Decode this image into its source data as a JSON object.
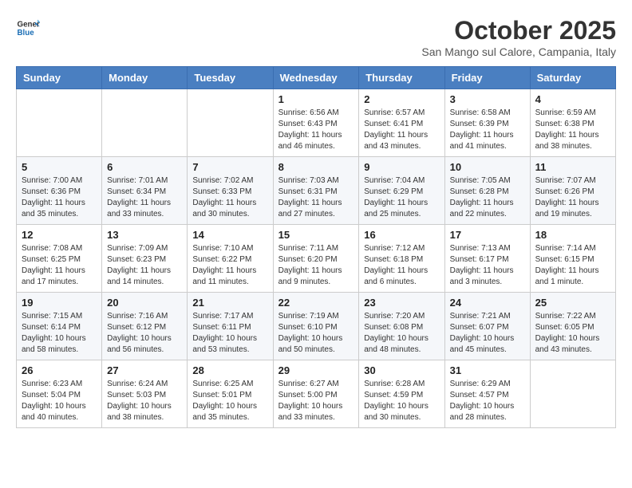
{
  "header": {
    "logo_line1": "General",
    "logo_line2": "Blue",
    "month": "October 2025",
    "location": "San Mango sul Calore, Campania, Italy"
  },
  "days_of_week": [
    "Sunday",
    "Monday",
    "Tuesday",
    "Wednesday",
    "Thursday",
    "Friday",
    "Saturday"
  ],
  "weeks": [
    [
      {
        "day": "",
        "info": ""
      },
      {
        "day": "",
        "info": ""
      },
      {
        "day": "",
        "info": ""
      },
      {
        "day": "1",
        "info": "Sunrise: 6:56 AM\nSunset: 6:43 PM\nDaylight: 11 hours and 46 minutes."
      },
      {
        "day": "2",
        "info": "Sunrise: 6:57 AM\nSunset: 6:41 PM\nDaylight: 11 hours and 43 minutes."
      },
      {
        "day": "3",
        "info": "Sunrise: 6:58 AM\nSunset: 6:39 PM\nDaylight: 11 hours and 41 minutes."
      },
      {
        "day": "4",
        "info": "Sunrise: 6:59 AM\nSunset: 6:38 PM\nDaylight: 11 hours and 38 minutes."
      }
    ],
    [
      {
        "day": "5",
        "info": "Sunrise: 7:00 AM\nSunset: 6:36 PM\nDaylight: 11 hours and 35 minutes."
      },
      {
        "day": "6",
        "info": "Sunrise: 7:01 AM\nSunset: 6:34 PM\nDaylight: 11 hours and 33 minutes."
      },
      {
        "day": "7",
        "info": "Sunrise: 7:02 AM\nSunset: 6:33 PM\nDaylight: 11 hours and 30 minutes."
      },
      {
        "day": "8",
        "info": "Sunrise: 7:03 AM\nSunset: 6:31 PM\nDaylight: 11 hours and 27 minutes."
      },
      {
        "day": "9",
        "info": "Sunrise: 7:04 AM\nSunset: 6:29 PM\nDaylight: 11 hours and 25 minutes."
      },
      {
        "day": "10",
        "info": "Sunrise: 7:05 AM\nSunset: 6:28 PM\nDaylight: 11 hours and 22 minutes."
      },
      {
        "day": "11",
        "info": "Sunrise: 7:07 AM\nSunset: 6:26 PM\nDaylight: 11 hours and 19 minutes."
      }
    ],
    [
      {
        "day": "12",
        "info": "Sunrise: 7:08 AM\nSunset: 6:25 PM\nDaylight: 11 hours and 17 minutes."
      },
      {
        "day": "13",
        "info": "Sunrise: 7:09 AM\nSunset: 6:23 PM\nDaylight: 11 hours and 14 minutes."
      },
      {
        "day": "14",
        "info": "Sunrise: 7:10 AM\nSunset: 6:22 PM\nDaylight: 11 hours and 11 minutes."
      },
      {
        "day": "15",
        "info": "Sunrise: 7:11 AM\nSunset: 6:20 PM\nDaylight: 11 hours and 9 minutes."
      },
      {
        "day": "16",
        "info": "Sunrise: 7:12 AM\nSunset: 6:18 PM\nDaylight: 11 hours and 6 minutes."
      },
      {
        "day": "17",
        "info": "Sunrise: 7:13 AM\nSunset: 6:17 PM\nDaylight: 11 hours and 3 minutes."
      },
      {
        "day": "18",
        "info": "Sunrise: 7:14 AM\nSunset: 6:15 PM\nDaylight: 11 hours and 1 minute."
      }
    ],
    [
      {
        "day": "19",
        "info": "Sunrise: 7:15 AM\nSunset: 6:14 PM\nDaylight: 10 hours and 58 minutes."
      },
      {
        "day": "20",
        "info": "Sunrise: 7:16 AM\nSunset: 6:12 PM\nDaylight: 10 hours and 56 minutes."
      },
      {
        "day": "21",
        "info": "Sunrise: 7:17 AM\nSunset: 6:11 PM\nDaylight: 10 hours and 53 minutes."
      },
      {
        "day": "22",
        "info": "Sunrise: 7:19 AM\nSunset: 6:10 PM\nDaylight: 10 hours and 50 minutes."
      },
      {
        "day": "23",
        "info": "Sunrise: 7:20 AM\nSunset: 6:08 PM\nDaylight: 10 hours and 48 minutes."
      },
      {
        "day": "24",
        "info": "Sunrise: 7:21 AM\nSunset: 6:07 PM\nDaylight: 10 hours and 45 minutes."
      },
      {
        "day": "25",
        "info": "Sunrise: 7:22 AM\nSunset: 6:05 PM\nDaylight: 10 hours and 43 minutes."
      }
    ],
    [
      {
        "day": "26",
        "info": "Sunrise: 6:23 AM\nSunset: 5:04 PM\nDaylight: 10 hours and 40 minutes."
      },
      {
        "day": "27",
        "info": "Sunrise: 6:24 AM\nSunset: 5:03 PM\nDaylight: 10 hours and 38 minutes."
      },
      {
        "day": "28",
        "info": "Sunrise: 6:25 AM\nSunset: 5:01 PM\nDaylight: 10 hours and 35 minutes."
      },
      {
        "day": "29",
        "info": "Sunrise: 6:27 AM\nSunset: 5:00 PM\nDaylight: 10 hours and 33 minutes."
      },
      {
        "day": "30",
        "info": "Sunrise: 6:28 AM\nSunset: 4:59 PM\nDaylight: 10 hours and 30 minutes."
      },
      {
        "day": "31",
        "info": "Sunrise: 6:29 AM\nSunset: 4:57 PM\nDaylight: 10 hours and 28 minutes."
      },
      {
        "day": "",
        "info": ""
      }
    ]
  ]
}
